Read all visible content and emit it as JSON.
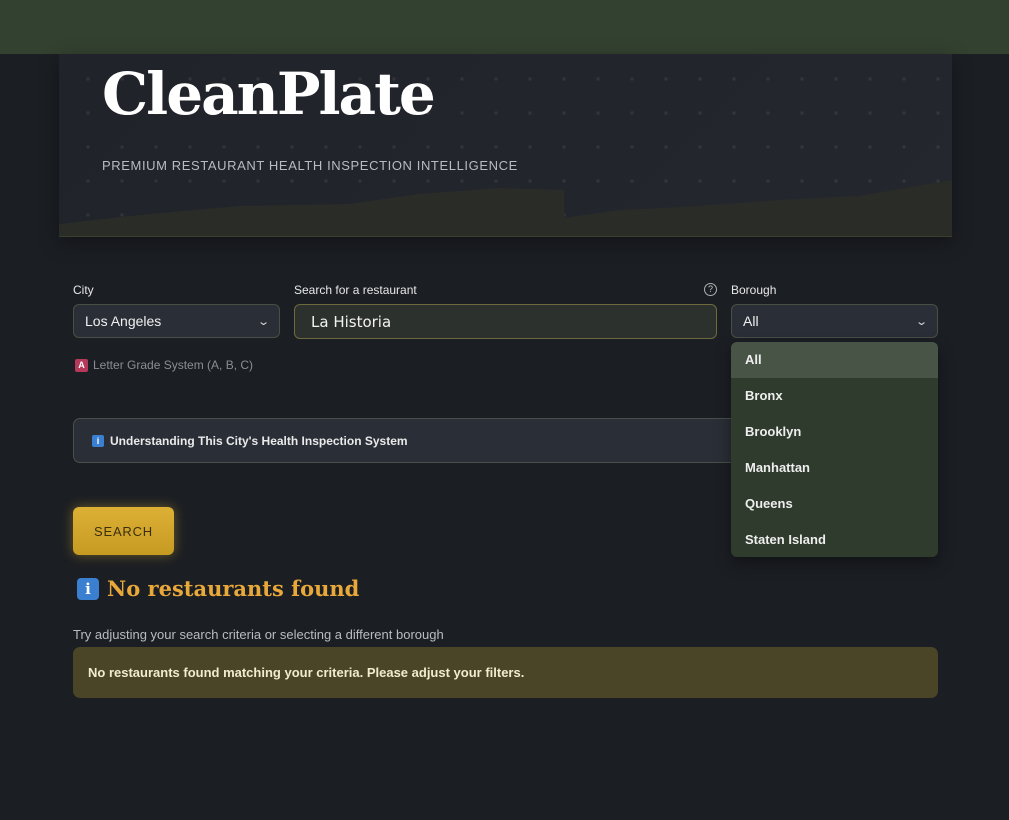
{
  "app": {
    "title": "CleanPlate",
    "subtitle": "PREMIUM RESTAURANT HEALTH INSPECTION INTELLIGENCE"
  },
  "filters": {
    "city_label": "City",
    "city_value": "Los Angeles",
    "search_label": "Search for a restaurant",
    "search_value": "La Historia",
    "help_icon": "?",
    "borough_label": "Borough",
    "borough_value": "All",
    "borough_options": [
      "All",
      "Bronx",
      "Brooklyn",
      "Manhattan",
      "Queens",
      "Staten Island"
    ],
    "grade_badge": "A",
    "grade_note": "Letter Grade System (A, B, C)"
  },
  "info_expander": {
    "icon": "i",
    "label": "Understanding This City's Health Inspection System"
  },
  "search_button": "SEARCH",
  "results": {
    "icon": "i",
    "title": "No restaurants found",
    "hint": "Try adjusting your search criteria or selecting a different borough",
    "alert": "No restaurants found matching your criteria. Please adjust your filters."
  },
  "colors": {
    "accent_gold": "#d6aa30",
    "title_orange": "#e8a83a",
    "topbar_green": "#334130",
    "alert_bg": "#4a4526"
  }
}
